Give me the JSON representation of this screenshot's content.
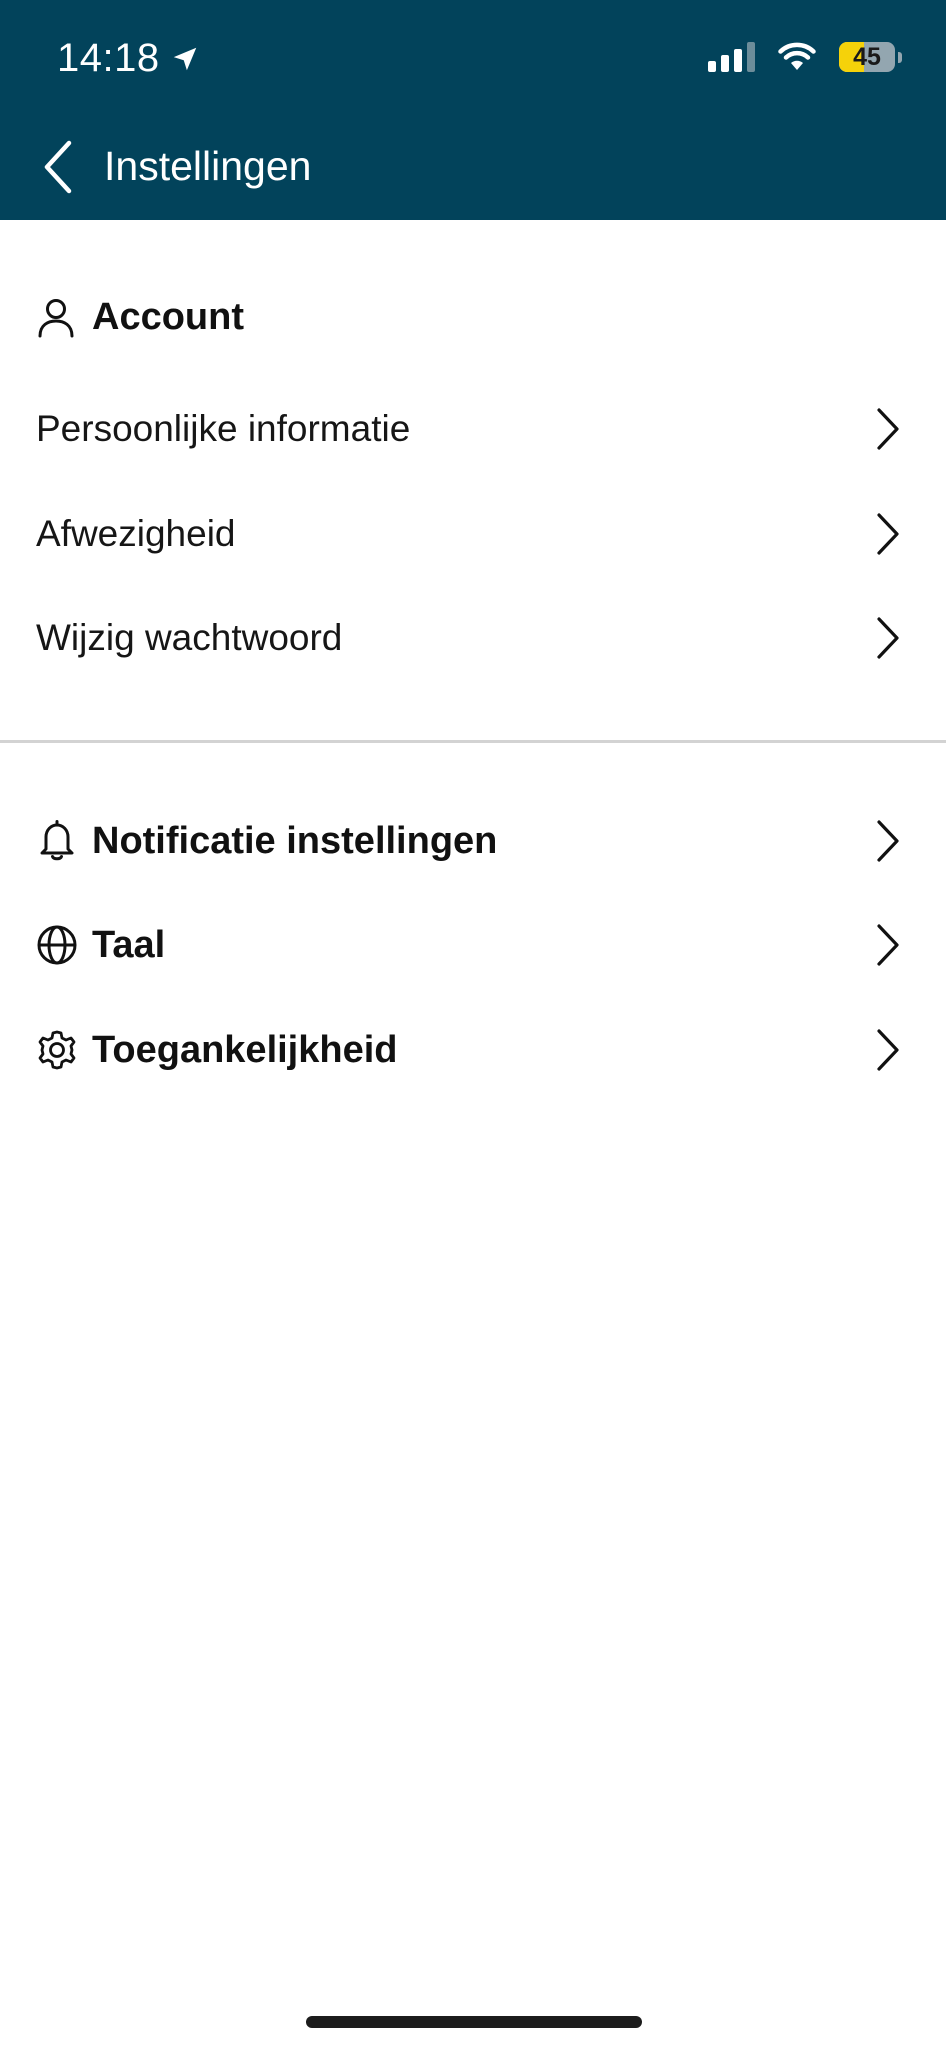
{
  "status_bar": {
    "time": "14:18",
    "battery_percent": "45",
    "battery_level": 0.45,
    "icons": [
      "location-arrow-icon",
      "signal-bars-icon",
      "wifi-icon",
      "battery-icon"
    ]
  },
  "header": {
    "title": "Instellingen",
    "back_icon": "chevron-left-icon",
    "background": "#02435b"
  },
  "account_section": {
    "title": "Account",
    "icon": "person-icon",
    "items": [
      {
        "label": "Persoonlijke informatie"
      },
      {
        "label": "Afwezigheid"
      },
      {
        "label": "Wijzig wachtwoord"
      }
    ]
  },
  "settings_items": [
    {
      "label": "Notificatie instellingen",
      "icon": "bell-icon"
    },
    {
      "label": "Taal",
      "icon": "globe-icon"
    },
    {
      "label": "Toegankelijkheid",
      "icon": "gear-icon"
    }
  ],
  "colors": {
    "header_bg": "#02435b",
    "battery_fill": "#f5d20a",
    "divider": "#d3d3d3",
    "text": "#111111"
  }
}
